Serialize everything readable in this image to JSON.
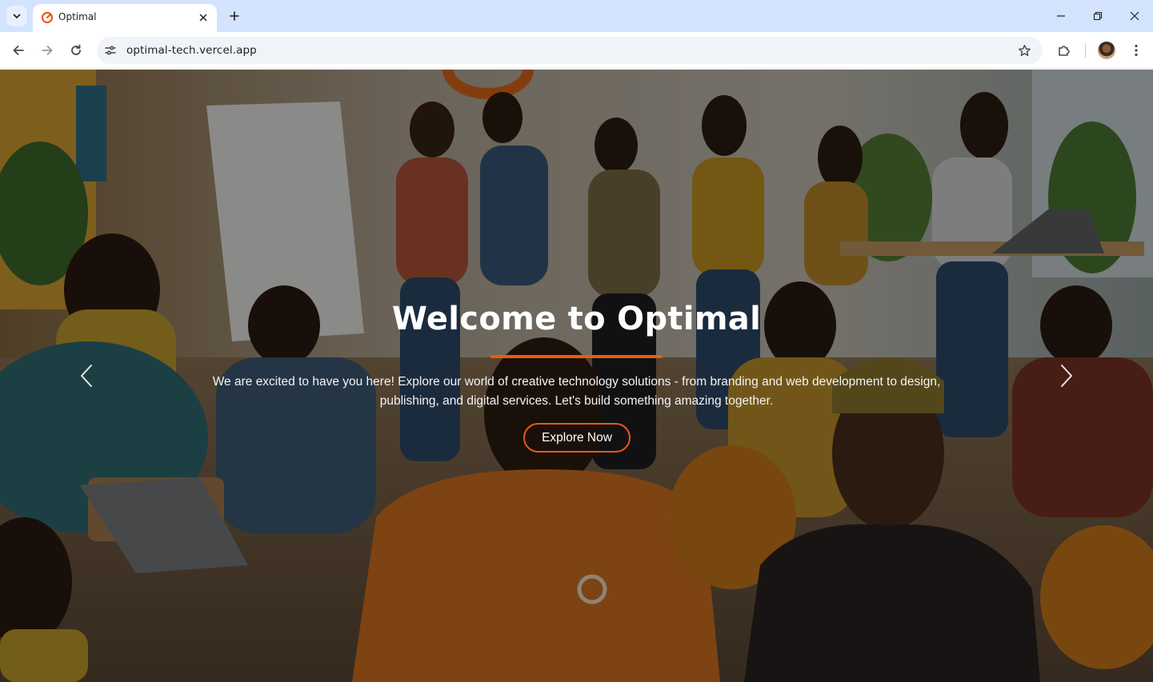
{
  "browser": {
    "tab_title": "Optimal",
    "url": "optimal-tech.vercel.app"
  },
  "hero": {
    "title": "Welcome to Optimal",
    "description": "We are excited to have you here! Explore our world of creative technology solutions - from branding and web development to design, publishing, and digital services. Let's build something amazing together.",
    "cta_label": "Explore Now",
    "accent_color": "#ea5a14"
  },
  "icons": {
    "tab_search": "chevron-down-icon",
    "favicon": "optimal-logo-icon",
    "tab_close": "close-icon",
    "new_tab": "plus-icon",
    "minimize": "minimize-icon",
    "restore": "restore-icon",
    "close_window": "close-icon",
    "back": "arrow-left-icon",
    "forward": "arrow-right-icon",
    "reload": "reload-icon",
    "site_info": "tune-icon",
    "bookmark": "star-icon",
    "extensions": "puzzle-icon",
    "profile": "avatar",
    "menu": "kebab-menu-icon",
    "carousel_prev": "chevron-left-icon",
    "carousel_next": "chevron-right-icon"
  }
}
